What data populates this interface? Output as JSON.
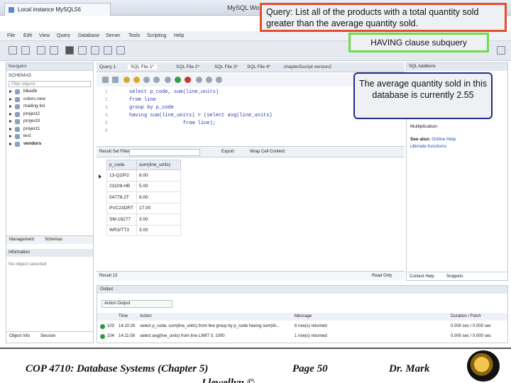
{
  "window": {
    "instance_tab": "Local instance MySQL56",
    "app_title": "MySQL Wo"
  },
  "menu": [
    "File",
    "Edit",
    "View",
    "Query",
    "Database",
    "Server",
    "Tools",
    "Scripting",
    "Help"
  ],
  "navigator": {
    "header": "Navigator",
    "schemas_label": "SCHEMAS",
    "filter_placeholder": "Filter objects",
    "schemas": [
      "bikedb",
      "colors.new",
      "mailing list",
      "project2",
      "project3",
      "project1",
      "test",
      "vendors"
    ],
    "subtabs": [
      "Management",
      "Schemas"
    ],
    "information_header": "Information",
    "no_object": "No object selected",
    "object_tabs": [
      "Object Info",
      "Session"
    ]
  },
  "editor": {
    "tabs": [
      "Query 1",
      "SQL File 1*",
      "SQL File 2*",
      "SQL File 3*",
      "SQL File 4*",
      "chapter5script version2"
    ],
    "code_lines": [
      "select p_code, sum(line_units)",
      "from line",
      "group by p_code",
      "having sum(line_units) > (select avg(line_units)",
      "                  from line);"
    ]
  },
  "results": {
    "filter_label": "Result Set Filter:",
    "export_label": "Export:",
    "wrap_label": "Wrap Cell Content:",
    "columns": [
      "p_code",
      "sum(line_units)"
    ],
    "rows": [
      [
        "13-Q2/P2",
        "8.00"
      ],
      [
        "23109-HB",
        "5.00"
      ],
      [
        "54778-2T",
        "6.00"
      ],
      [
        "PVC23DRT",
        "17.00"
      ],
      [
        "SM-18277",
        "3.00"
      ],
      [
        "WR3/TT3",
        "3.00"
      ]
    ],
    "result_tab": "Result 13",
    "read_only": "Read Only"
  },
  "sql_additions": {
    "header": "SQL Additions",
    "multiplication": "Multiplication:",
    "see_also_label": "See also:",
    "see_also_link": "Online Help",
    "link2": "ultimate-functions",
    "tabs": [
      "Context Help",
      "Snippets"
    ]
  },
  "output": {
    "header": "Output",
    "selector": "Action Output",
    "columns": [
      "Time",
      "Action",
      "Message",
      "Duration / Fetch"
    ],
    "rows": [
      {
        "num": "103",
        "time": "14:10:26",
        "action": "select p_code, sum(line_units) from line group by p_code having sum(lin...",
        "message": "6 row(s) returned",
        "duration": "0.000 sec / 0.000 sec"
      },
      {
        "num": "104",
        "time": "14:11:08",
        "action": "select avg(line_units) from line LIMIT 0, 1000",
        "message": "1 row(s) returned",
        "duration": "0.000 sec / 0.000 sec"
      }
    ]
  },
  "annotations": {
    "query": "Query:  List all of the products with a total quantity sold greater than the average quantity sold.",
    "having": "HAVING clause subquery",
    "average": "The average quantity sold in this database is currently 2.55"
  },
  "footer": {
    "course": "COP 4710: Database Systems  (Chapter 5)",
    "page": "Page 50",
    "author": "Dr. Mark",
    "author_cut": "Llewellyn ©"
  }
}
